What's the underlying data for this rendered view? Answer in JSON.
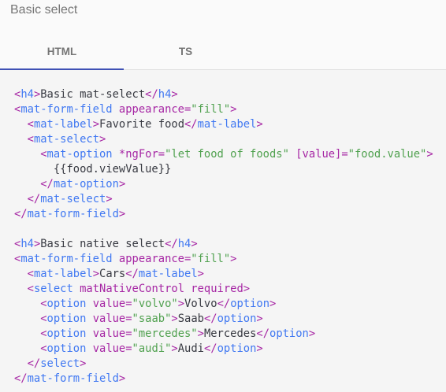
{
  "title": "Basic select",
  "tabs": [
    {
      "label": "HTML",
      "active": true
    },
    {
      "label": "TS",
      "active": false
    }
  ],
  "colors": {
    "accent": "#3f51b5",
    "tag": "#4078f2",
    "attr": "#a626a4",
    "string": "#50a14f"
  },
  "code": [
    [
      [
        "p",
        "<"
      ],
      [
        "t",
        "h4"
      ],
      [
        "p",
        ">"
      ],
      [
        "x",
        "Basic mat-select"
      ],
      [
        "p",
        "</"
      ],
      [
        "t",
        "h4"
      ],
      [
        "p",
        ">"
      ]
    ],
    [
      [
        "p",
        "<"
      ],
      [
        "t",
        "mat-form-field "
      ],
      [
        "a",
        "appearance="
      ],
      [
        "s",
        "\"fill\""
      ],
      [
        "p",
        ">"
      ]
    ],
    [
      [
        "x",
        "  "
      ],
      [
        "p",
        "<"
      ],
      [
        "t",
        "mat-label"
      ],
      [
        "p",
        ">"
      ],
      [
        "x",
        "Favorite food"
      ],
      [
        "p",
        "</"
      ],
      [
        "t",
        "mat-label"
      ],
      [
        "p",
        ">"
      ]
    ],
    [
      [
        "x",
        "  "
      ],
      [
        "p",
        "<"
      ],
      [
        "t",
        "mat-select"
      ],
      [
        "p",
        ">"
      ]
    ],
    [
      [
        "x",
        "    "
      ],
      [
        "p",
        "<"
      ],
      [
        "t",
        "mat-option "
      ],
      [
        "a",
        "*ngFor="
      ],
      [
        "s",
        "\"let food of foods\" "
      ],
      [
        "a",
        "[value]="
      ],
      [
        "s",
        "\"food.value\""
      ],
      [
        "p",
        ">"
      ]
    ],
    [
      [
        "x",
        "      {{food.viewValue}}"
      ]
    ],
    [
      [
        "x",
        "    "
      ],
      [
        "p",
        "</"
      ],
      [
        "t",
        "mat-option"
      ],
      [
        "p",
        ">"
      ]
    ],
    [
      [
        "x",
        "  "
      ],
      [
        "p",
        "</"
      ],
      [
        "t",
        "mat-select"
      ],
      [
        "p",
        ">"
      ]
    ],
    [
      [
        "p",
        "</"
      ],
      [
        "t",
        "mat-form-field"
      ],
      [
        "p",
        ">"
      ]
    ],
    [],
    [
      [
        "p",
        "<"
      ],
      [
        "t",
        "h4"
      ],
      [
        "p",
        ">"
      ],
      [
        "x",
        "Basic native select"
      ],
      [
        "p",
        "</"
      ],
      [
        "t",
        "h4"
      ],
      [
        "p",
        ">"
      ]
    ],
    [
      [
        "p",
        "<"
      ],
      [
        "t",
        "mat-form-field "
      ],
      [
        "a",
        "appearance="
      ],
      [
        "s",
        "\"fill\""
      ],
      [
        "p",
        ">"
      ]
    ],
    [
      [
        "x",
        "  "
      ],
      [
        "p",
        "<"
      ],
      [
        "t",
        "mat-label"
      ],
      [
        "p",
        ">"
      ],
      [
        "x",
        "Cars"
      ],
      [
        "p",
        "</"
      ],
      [
        "t",
        "mat-label"
      ],
      [
        "p",
        ">"
      ]
    ],
    [
      [
        "x",
        "  "
      ],
      [
        "p",
        "<"
      ],
      [
        "t",
        "select "
      ],
      [
        "a",
        "matNativeControl required"
      ],
      [
        "p",
        ">"
      ]
    ],
    [
      [
        "x",
        "    "
      ],
      [
        "p",
        "<"
      ],
      [
        "t",
        "option "
      ],
      [
        "a",
        "value="
      ],
      [
        "s",
        "\"volvo\""
      ],
      [
        "p",
        ">"
      ],
      [
        "x",
        "Volvo"
      ],
      [
        "p",
        "</"
      ],
      [
        "t",
        "option"
      ],
      [
        "p",
        ">"
      ]
    ],
    [
      [
        "x",
        "    "
      ],
      [
        "p",
        "<"
      ],
      [
        "t",
        "option "
      ],
      [
        "a",
        "value="
      ],
      [
        "s",
        "\"saab\""
      ],
      [
        "p",
        ">"
      ],
      [
        "x",
        "Saab"
      ],
      [
        "p",
        "</"
      ],
      [
        "t",
        "option"
      ],
      [
        "p",
        ">"
      ]
    ],
    [
      [
        "x",
        "    "
      ],
      [
        "p",
        "<"
      ],
      [
        "t",
        "option "
      ],
      [
        "a",
        "value="
      ],
      [
        "s",
        "\"mercedes\""
      ],
      [
        "p",
        ">"
      ],
      [
        "x",
        "Mercedes"
      ],
      [
        "p",
        "</"
      ],
      [
        "t",
        "option"
      ],
      [
        "p",
        ">"
      ]
    ],
    [
      [
        "x",
        "    "
      ],
      [
        "p",
        "<"
      ],
      [
        "t",
        "option "
      ],
      [
        "a",
        "value="
      ],
      [
        "s",
        "\"audi\""
      ],
      [
        "p",
        ">"
      ],
      [
        "x",
        "Audi"
      ],
      [
        "p",
        "</"
      ],
      [
        "t",
        "option"
      ],
      [
        "p",
        ">"
      ]
    ],
    [
      [
        "x",
        "  "
      ],
      [
        "p",
        "</"
      ],
      [
        "t",
        "select"
      ],
      [
        "p",
        ">"
      ]
    ],
    [
      [
        "p",
        "</"
      ],
      [
        "t",
        "mat-form-field"
      ],
      [
        "p",
        ">"
      ]
    ]
  ]
}
